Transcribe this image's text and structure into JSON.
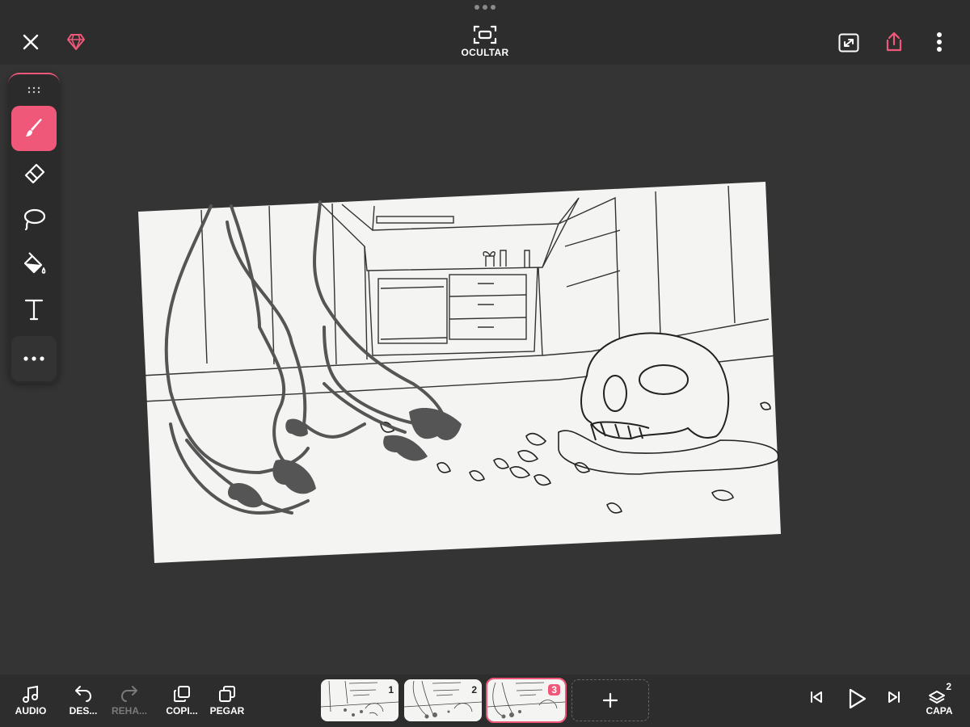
{
  "topbar": {
    "hide_label": "OCULTAR",
    "icons": {
      "close": "close-icon",
      "premium": "diamond-icon",
      "hide": "hide-ui-icon",
      "fullscreen": "expand-icon",
      "share": "share-icon",
      "more": "more-vertical-icon"
    }
  },
  "tools": [
    {
      "name": "brush",
      "icon": "brush-icon",
      "active": true
    },
    {
      "name": "eraser",
      "icon": "eraser-icon",
      "active": false
    },
    {
      "name": "lasso",
      "icon": "lasso-icon",
      "active": false
    },
    {
      "name": "fill",
      "icon": "paint-bucket-icon",
      "active": false
    },
    {
      "name": "text",
      "icon": "text-icon",
      "active": false
    },
    {
      "name": "more",
      "icon": "more-horizontal-icon",
      "active": false
    }
  ],
  "bottombar": {
    "audio_label": "AUDIO",
    "undo_label": "DES...",
    "redo_label": "REHA...",
    "copy_label": "COPI...",
    "paste_label": "PEGAR",
    "layer_label": "CAPA",
    "layer_count": "2",
    "frames": [
      {
        "number": "1",
        "active": false
      },
      {
        "number": "2",
        "active": false
      },
      {
        "number": "3",
        "active": true
      }
    ]
  },
  "colors": {
    "accent": "#f0587a",
    "background": "#343434",
    "bar": "#2d2d2d",
    "paper": "#f4f4f2",
    "ink": "#222222",
    "shade": "#555555"
  }
}
